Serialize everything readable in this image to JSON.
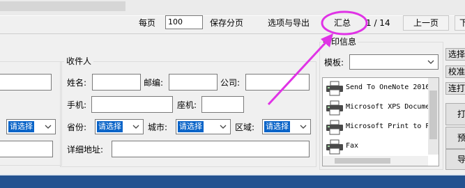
{
  "toolbar": {
    "per_page_label": "每页",
    "per_page_value": "100",
    "save_page_label": "保存分页",
    "options_export_label": "选项与导出",
    "summary_label": "汇总",
    "page_indicator": "1 / 14",
    "prev_page_label": "上一页",
    "next_page_partial": "下"
  },
  "recipient": {
    "title": "收件人",
    "name_label": "姓名:",
    "zip_label": "邮编:",
    "company_label": "公司:",
    "mobile_label": "手机:",
    "landline_label": "座机:",
    "province_label": "省份:",
    "city_label": "城市:",
    "district_label": "区域:",
    "address_label": "详细地址:",
    "province_value": "请选择",
    "city_value": "请选择",
    "district_value": "请选择"
  },
  "sender": {
    "province_value": "请选择"
  },
  "print_info": {
    "title": "打印信息",
    "template_label": "模板:",
    "template_value": "",
    "printers": [
      "Send To OneNote 2016",
      "Microsoft XPS Docume",
      "Microsoft Print to P",
      "Fax"
    ]
  },
  "side_buttons": {
    "select": "选择",
    "calibrate": "校准",
    "continuous": "连打",
    "print": "打",
    "preview": "预",
    "export": "导"
  },
  "colors": {
    "annotation": "#e033e6",
    "selection": "#0a64c8",
    "taskbar": "#245290"
  },
  "icons": {
    "printer": "printer-icon",
    "dropdown": "chevron-down-icon"
  }
}
